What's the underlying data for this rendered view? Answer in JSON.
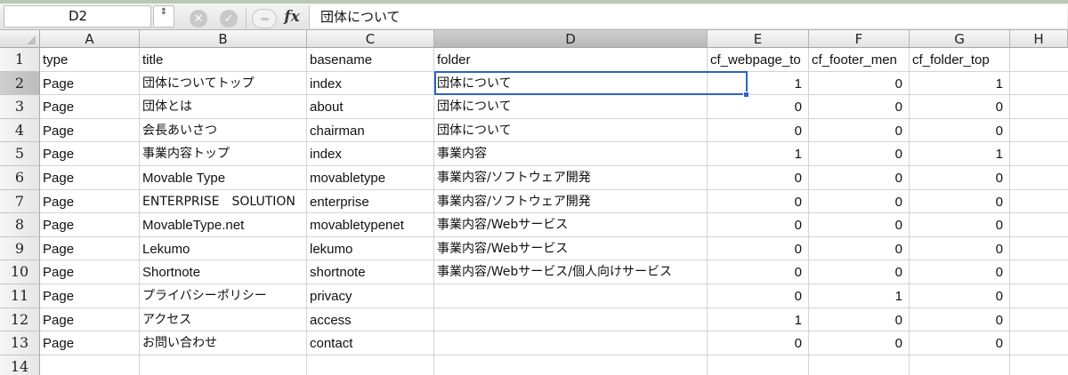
{
  "formula_bar": {
    "name_box": "D2",
    "stepper_icon": "⇕",
    "cancel_icon": "✕",
    "enter_icon": "✓",
    "fx_label": "fx",
    "content": "団体について"
  },
  "columns": [
    "A",
    "B",
    "C",
    "D",
    "E",
    "F",
    "G",
    "H"
  ],
  "selected_column": "D",
  "selected_row": 2,
  "accent_color": "#2e62c9",
  "rows": [
    {
      "n": "1",
      "cells": [
        "type",
        "title",
        "basename",
        "folder",
        "cf_webpage_to",
        "cf_footer_men",
        "cf_folder_top"
      ]
    },
    {
      "n": "2",
      "cells": [
        "Page",
        "団体についてトップ",
        "index",
        "団体について",
        "1",
        "0",
        "1"
      ]
    },
    {
      "n": "3",
      "cells": [
        "Page",
        "団体とは",
        "about",
        "団体について",
        "0",
        "0",
        "0"
      ]
    },
    {
      "n": "4",
      "cells": [
        "Page",
        "会長あいさつ",
        "chairman",
        "団体について",
        "0",
        "0",
        "0"
      ]
    },
    {
      "n": "5",
      "cells": [
        "Page",
        "事業内容トップ",
        "index",
        "事業内容",
        "1",
        "0",
        "1"
      ]
    },
    {
      "n": "6",
      "cells": [
        "Page",
        "Movable Type",
        "movabletype",
        "事業内容/ソフトウェア開発",
        "0",
        "0",
        "0"
      ]
    },
    {
      "n": "7",
      "cells": [
        "Page",
        "ENTERPRISE　SOLUTION",
        "enterprise",
        "事業内容/ソフトウェア開発",
        "0",
        "0",
        "0"
      ]
    },
    {
      "n": "8",
      "cells": [
        "Page",
        "MovableType.net",
        "movabletypenet",
        "事業内容/Webサービス",
        "0",
        "0",
        "0"
      ]
    },
    {
      "n": "9",
      "cells": [
        "Page",
        "Lekumo",
        "lekumo",
        "事業内容/Webサービス",
        "0",
        "0",
        "0"
      ]
    },
    {
      "n": "10",
      "cells": [
        "Page",
        "Shortnote",
        "shortnote",
        "事業内容/Webサービス/個人向けサービス",
        "0",
        "0",
        "0"
      ]
    },
    {
      "n": "11",
      "cells": [
        "Page",
        "プライバシーポリシー",
        "privacy",
        "",
        "0",
        "1",
        "0"
      ]
    },
    {
      "n": "12",
      "cells": [
        "Page",
        "アクセス",
        "access",
        "",
        "1",
        "0",
        "0"
      ]
    },
    {
      "n": "13",
      "cells": [
        "Page",
        "お問い合わせ",
        "contact",
        "",
        "0",
        "0",
        "0"
      ]
    },
    {
      "n": "14",
      "cells": [
        "",
        "",
        "",
        "",
        "",
        "",
        ""
      ]
    }
  ]
}
